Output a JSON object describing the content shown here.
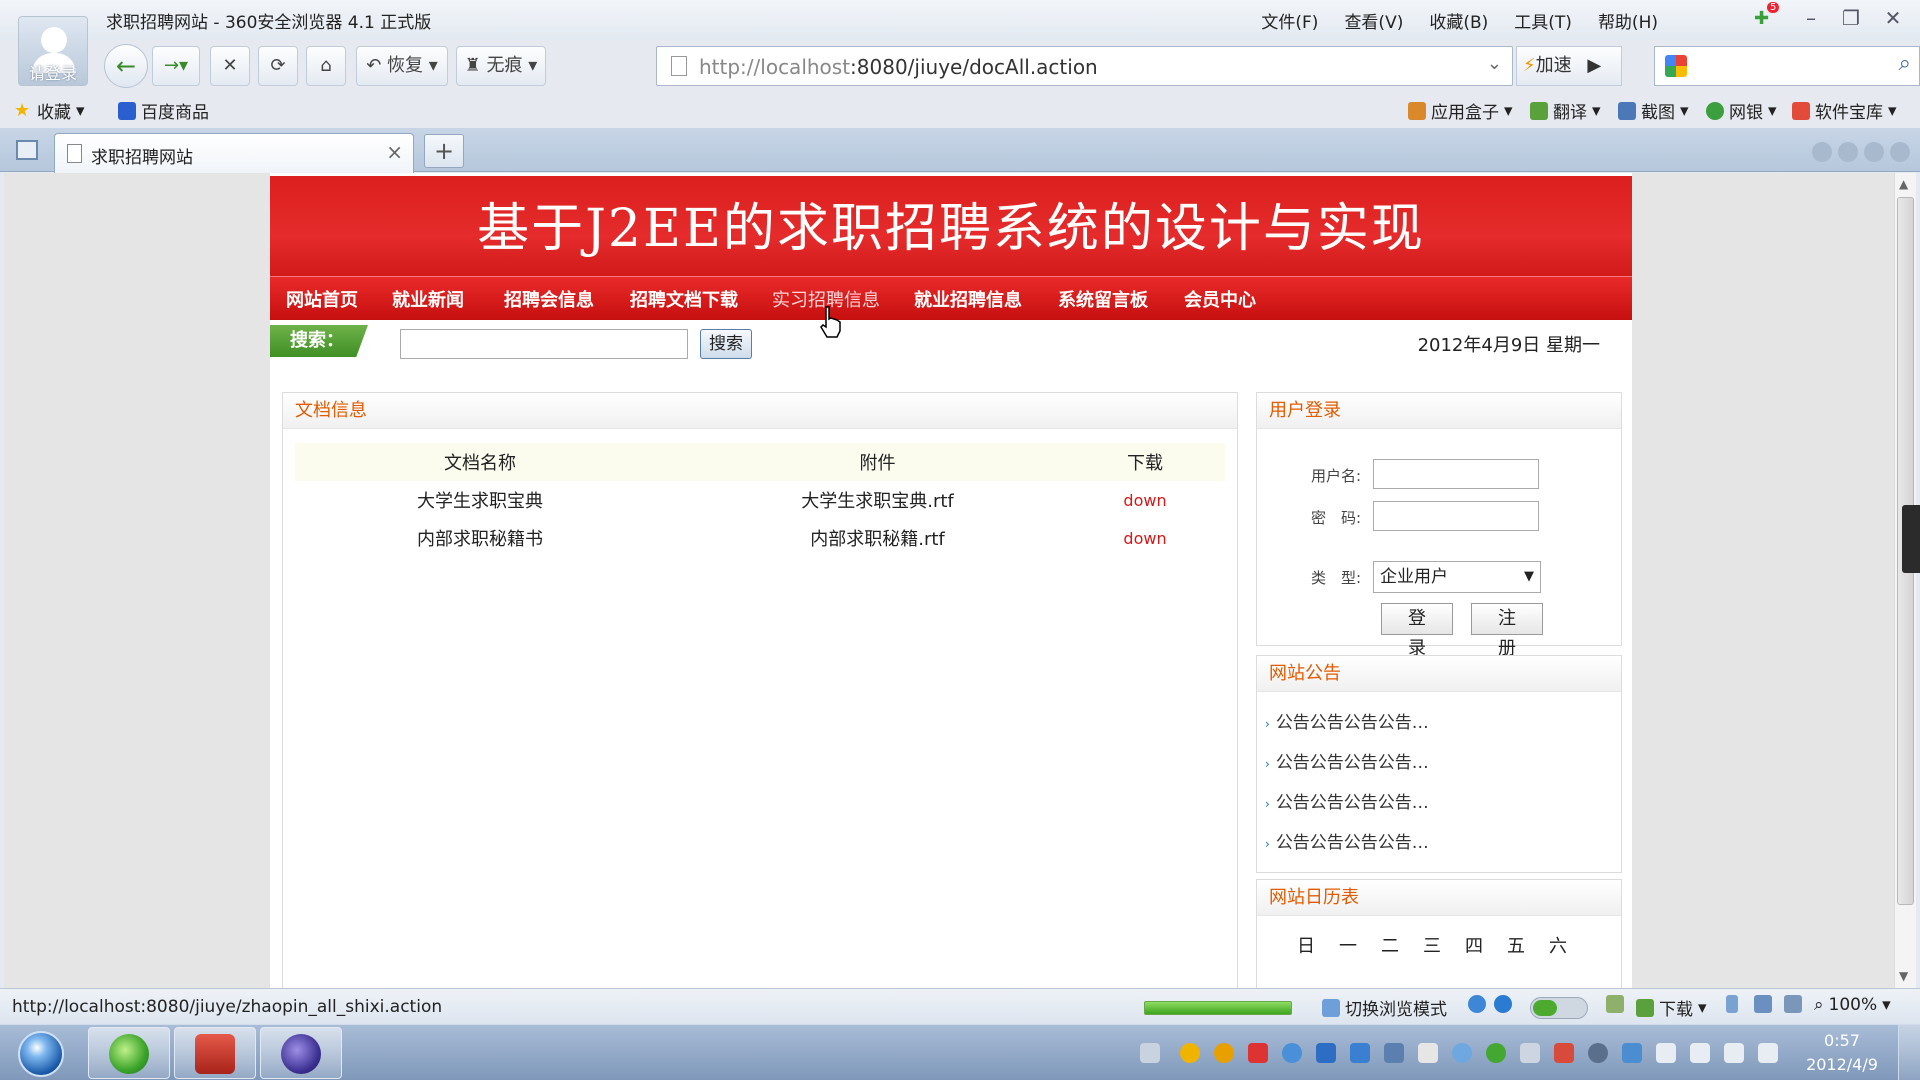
{
  "browser": {
    "login_label": "请登录",
    "window_title": "求职招聘网站 - 360安全浏览器 4.1 正式版",
    "menu": [
      "文件(F)",
      "查看(V)",
      "收藏(B)",
      "工具(T)",
      "帮助(H)"
    ],
    "pin_badge": "5",
    "toolbar": {
      "restore_label": "恢复",
      "incognito_label": "无痕",
      "url_host": "http://localhost",
      "url_rest": ":8080/jiuye/docAll.action",
      "speed_label": "加速"
    },
    "favbar": {
      "favorites_label": "收藏",
      "baidu_label": "百度商品",
      "appbox_label": "应用盒子",
      "translate_label": "翻译",
      "screenshot_label": "截图",
      "netbank_label": "网银",
      "software_label": "软件宝库"
    },
    "tab": {
      "title": "求职招聘网站"
    }
  },
  "site": {
    "banner_title": "基于J2EE的求职招聘系统的设计与实现",
    "nav": [
      "网站首页",
      "就业新闻",
      "招聘会信息",
      "招聘文档下载",
      "实习招聘信息",
      "就业招聘信息",
      "系统留言板",
      "会员中心"
    ],
    "search": {
      "label": "搜索：",
      "button": "搜索",
      "value": ""
    },
    "date": "2012年4月9日 星期一",
    "docs": {
      "title": "文档信息",
      "headers": [
        "文档名称",
        "附件",
        "下载"
      ],
      "rows": [
        {
          "name": "大学生求职宝典",
          "file": "大学生求职宝典.rtf",
          "action": "down"
        },
        {
          "name": "内部求职秘籍书",
          "file": "内部求职秘籍.rtf",
          "action": "down"
        }
      ]
    },
    "login": {
      "title": "用户登录",
      "username_label": "用户名:",
      "password_label": "密　码:",
      "type_label": "类　型:",
      "type_value": "企业用户",
      "login_button": "登 录",
      "register_button": "注 册"
    },
    "notice": {
      "title": "网站公告",
      "items": [
        "公告公告公告公告…",
        "公告公告公告公告…",
        "公告公告公告公告…",
        "公告公告公告公告…"
      ]
    },
    "calendar": {
      "title": "网站日历表",
      "weekdays": [
        "日",
        "一",
        "二",
        "三",
        "四",
        "五",
        "六"
      ]
    }
  },
  "statusbar": {
    "url": "http://localhost:8080/jiuye/zhaopin_all_shixi.action",
    "switch_mode": "切换浏览模式",
    "download_label": "下载",
    "zoom": "100%"
  },
  "taskbar": {
    "time": "0:57",
    "date": "2012/4/9"
  },
  "colors": {
    "banner_red": "#e02424",
    "panel_title": "#e25b00",
    "down_link": "#d61818",
    "search_green": "#4f9d2f"
  }
}
